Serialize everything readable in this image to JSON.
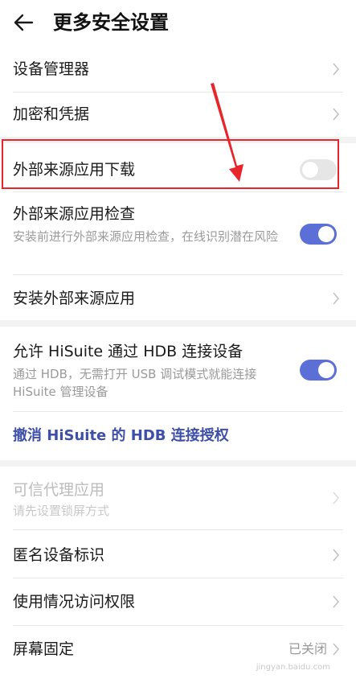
{
  "header": {
    "title": "更多安全设置"
  },
  "group1": {
    "device_admin": "设备管理器",
    "credentials": "加密和凭据"
  },
  "group2": {
    "external_download": "外部来源应用下载",
    "external_check_title": "外部来源应用检查",
    "external_check_sub": "安装前进行外部来源应用检查，在线识别潜在风险",
    "install_external": "安装外部来源应用"
  },
  "group3": {
    "hdb_title": "允许 HiSuite 通过 HDB 连接设备",
    "hdb_sub": "通过 HDB，无需打开 USB 调试模式就能连接 HiSuite 管理设备",
    "revoke": "撤消 HiSuite 的 HDB 连接授权"
  },
  "group4": {
    "trust_agent_title": "可信代理应用",
    "trust_agent_sub": "请先设置锁屏方式",
    "anon_id": "匿名设备标识",
    "usage_access": "使用情况访问权限",
    "screen_pin": "屏幕固定",
    "screen_pin_status": "已关闭"
  },
  "states": {
    "external_download_on": false,
    "external_check_on": true,
    "hdb_on": true
  },
  "colors": {
    "toggle_on": "#5b6fd6",
    "link": "#3d4fa8",
    "annotation": "#e8252b"
  },
  "watermark": "jingyan.baidu.com"
}
